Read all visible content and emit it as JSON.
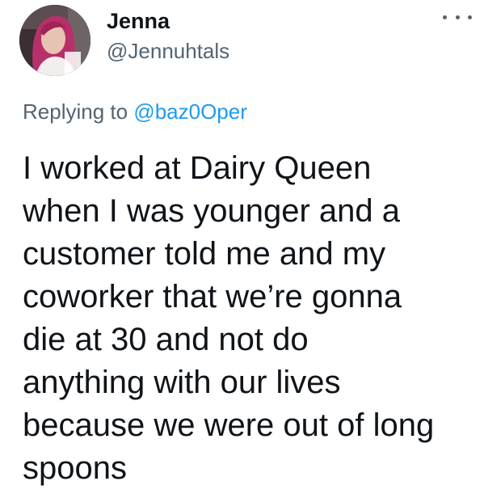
{
  "author": {
    "name": "Jenna",
    "handle": "@Jennuhtals",
    "avatar_icon": "profile-photo"
  },
  "more_icon": "more-horizontal-icon",
  "reply": {
    "prefix": "Replying to",
    "mention": "@baz0Oper"
  },
  "tweet": {
    "lines": [
      "I worked at Dairy Queen",
      "when I was younger and a",
      "customer told me and my",
      "coworker that we’re gonna",
      "die at 30 and not do",
      "anything with our lives",
      "because we were out of long",
      "spoons"
    ]
  },
  "colors": {
    "text": "#0f1419",
    "secondary": "#536471",
    "link": "#1d9bf0",
    "background": "#ffffff"
  }
}
